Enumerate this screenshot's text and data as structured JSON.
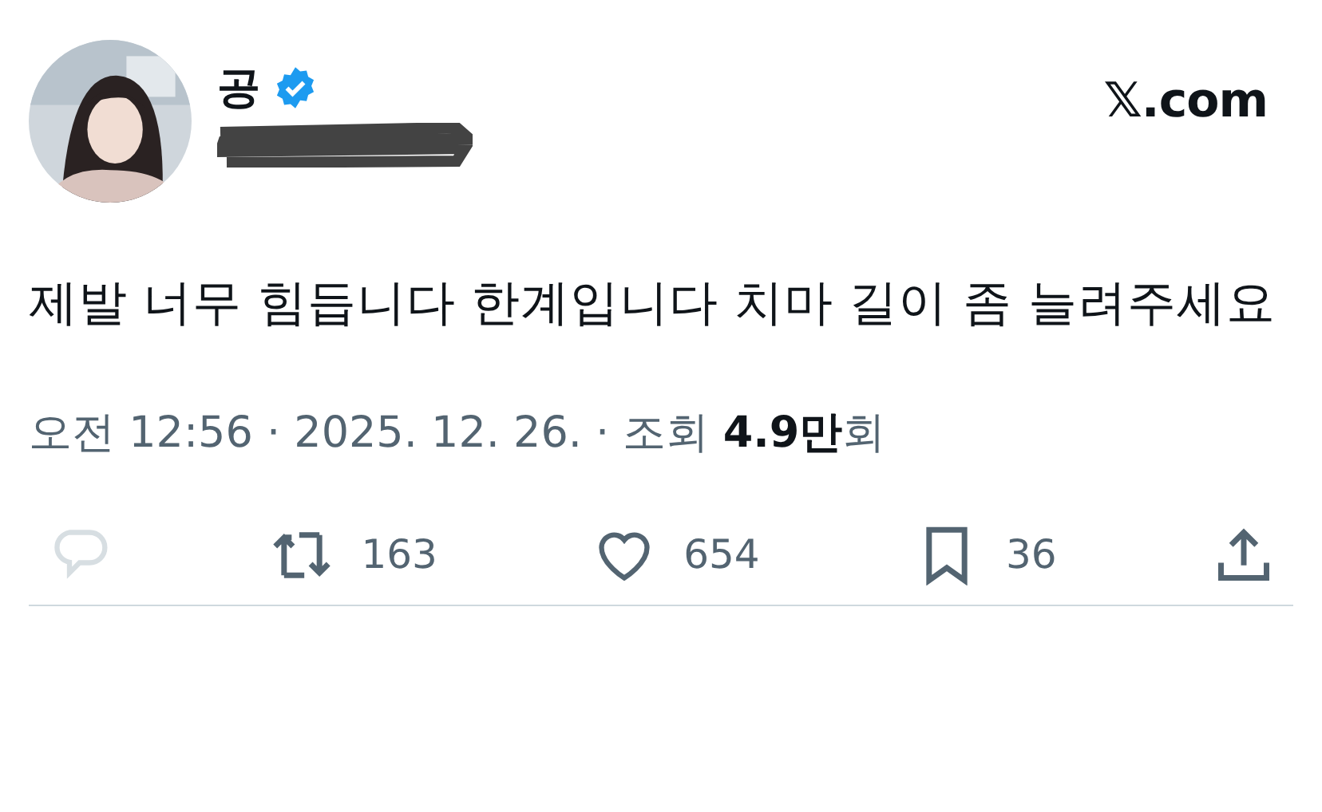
{
  "author": {
    "name": "공",
    "verified": true,
    "handle_redacted": true
  },
  "site": "𝕏.com",
  "text": "제발 너무 힘듭니다 한계입니다 치마 길이 좀 늘려주세요",
  "meta": "오전 12:56 · 2025. 12. 26. · 조회 **4.9만**회",
  "actions": [
    {
      "kind": "reply",
      "disabled": true
    },
    {
      "kind": "repost",
      "count": "163",
      "disabled": false
    },
    {
      "kind": "like",
      "count": "654",
      "disabled": false
    },
    {
      "kind": "bookmark",
      "count": "36",
      "disabled": false
    },
    {
      "kind": "share",
      "disabled": false
    }
  ]
}
